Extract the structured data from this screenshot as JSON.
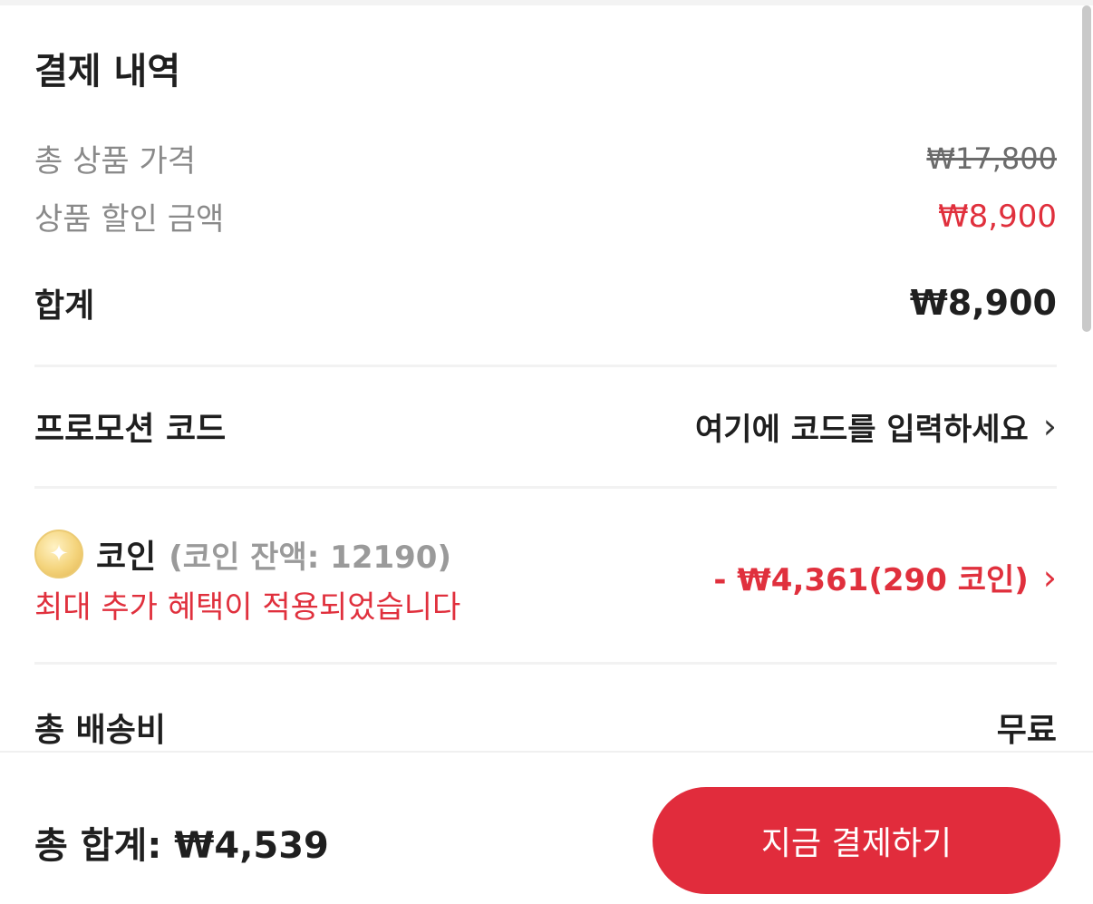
{
  "summary": {
    "title": "결제 내역",
    "total_product_price_label": "총 상품 가격",
    "total_product_price_value": "₩17,800",
    "discount_label": "상품 할인 금액",
    "discount_value": "₩8,900",
    "sum_label": "합계",
    "sum_value": "₩8,900"
  },
  "promo": {
    "label": "프로모션 코드",
    "placeholder": "여기에 코드를 입력하세요",
    "chevron": "›"
  },
  "coin": {
    "icon": "coin-icon",
    "icon_glyph": "✦",
    "label": "코인",
    "balance_text": "(코인 잔액: 12190)",
    "note": "최대 추가 혜택이 적용되었습니다",
    "amount": "- ₩4,361(290 코인)",
    "chevron": "›"
  },
  "shipping": {
    "label": "총 배송비",
    "value": "무료"
  },
  "footer": {
    "grand_total": "총 합계: ₩4,539",
    "pay_button_label": "지금 결제하기"
  },
  "colors": {
    "accent_red": "#e12c3c",
    "text_dark": "#1f1f1f",
    "text_muted": "#8a8a8a"
  }
}
